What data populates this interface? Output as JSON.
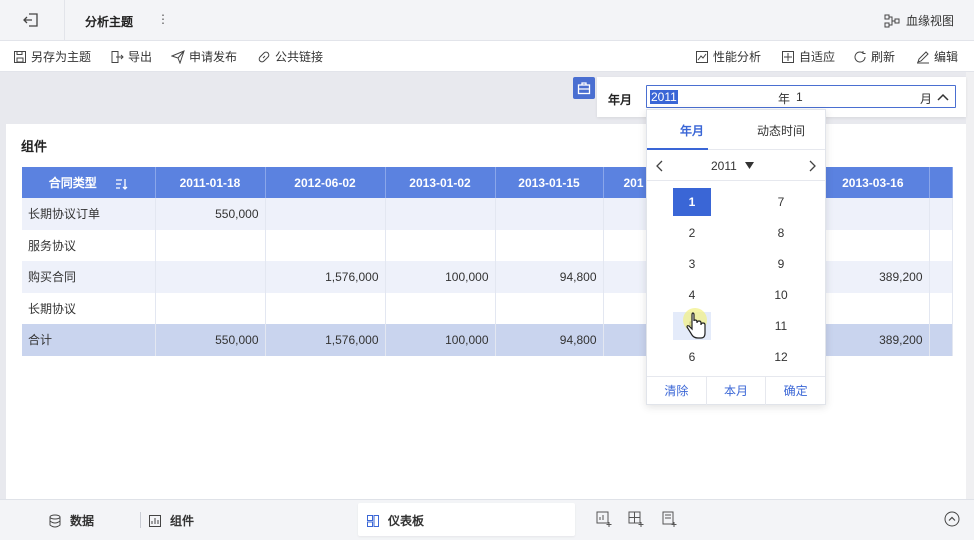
{
  "titlebar": {
    "title": "分析主题",
    "more": "⋮",
    "lineage": "血缘视图"
  },
  "toolbar": {
    "save_as": "另存为主题",
    "export": "导出",
    "publish": "申请发布",
    "public_link": "公共链接",
    "perf": "性能分析",
    "adapt": "自适应",
    "refresh": "刷新",
    "edit": "编辑"
  },
  "filter": {
    "label": "年月",
    "year_value": "2011",
    "year_unit": "年",
    "month_value": "1",
    "month_unit": "月"
  },
  "card": {
    "title": "组件",
    "columns": [
      "合同类型",
      "2011-01-18",
      "2012-06-02",
      "2013-01-02",
      "2013-01-15",
      "201",
      "2013-03-16"
    ],
    "rows": [
      [
        "长期协议订单",
        "550,000",
        "",
        "",
        "",
        "",
        ""
      ],
      [
        "服务协议",
        "",
        "",
        "",
        "",
        "",
        ""
      ],
      [
        "购买合同",
        "",
        "1,576,000",
        "100,000",
        "94,800",
        "",
        "389,200"
      ],
      [
        "长期协议",
        "",
        "",
        "",
        "",
        "",
        ""
      ]
    ],
    "total": [
      "合计",
      "550,000",
      "1,576,000",
      "100,000",
      "94,800",
      "",
      "389,200"
    ]
  },
  "picker": {
    "tab_month": "年月",
    "tab_dynamic": "动态时间",
    "year": "2011",
    "months_left": [
      "1",
      "2",
      "3",
      "4",
      "5",
      "6"
    ],
    "months_right": [
      "7",
      "8",
      "9",
      "10",
      "11",
      "12"
    ],
    "selected_month": "1",
    "clear": "清除",
    "this_month": "本月",
    "confirm": "确定"
  },
  "bottombar": {
    "data": "数据",
    "component": "组件",
    "dashboard": "仪表板"
  },
  "colors": {
    "accent": "#3a66d6",
    "header": "#5b82e0",
    "total_row": "#c9d4ee"
  }
}
